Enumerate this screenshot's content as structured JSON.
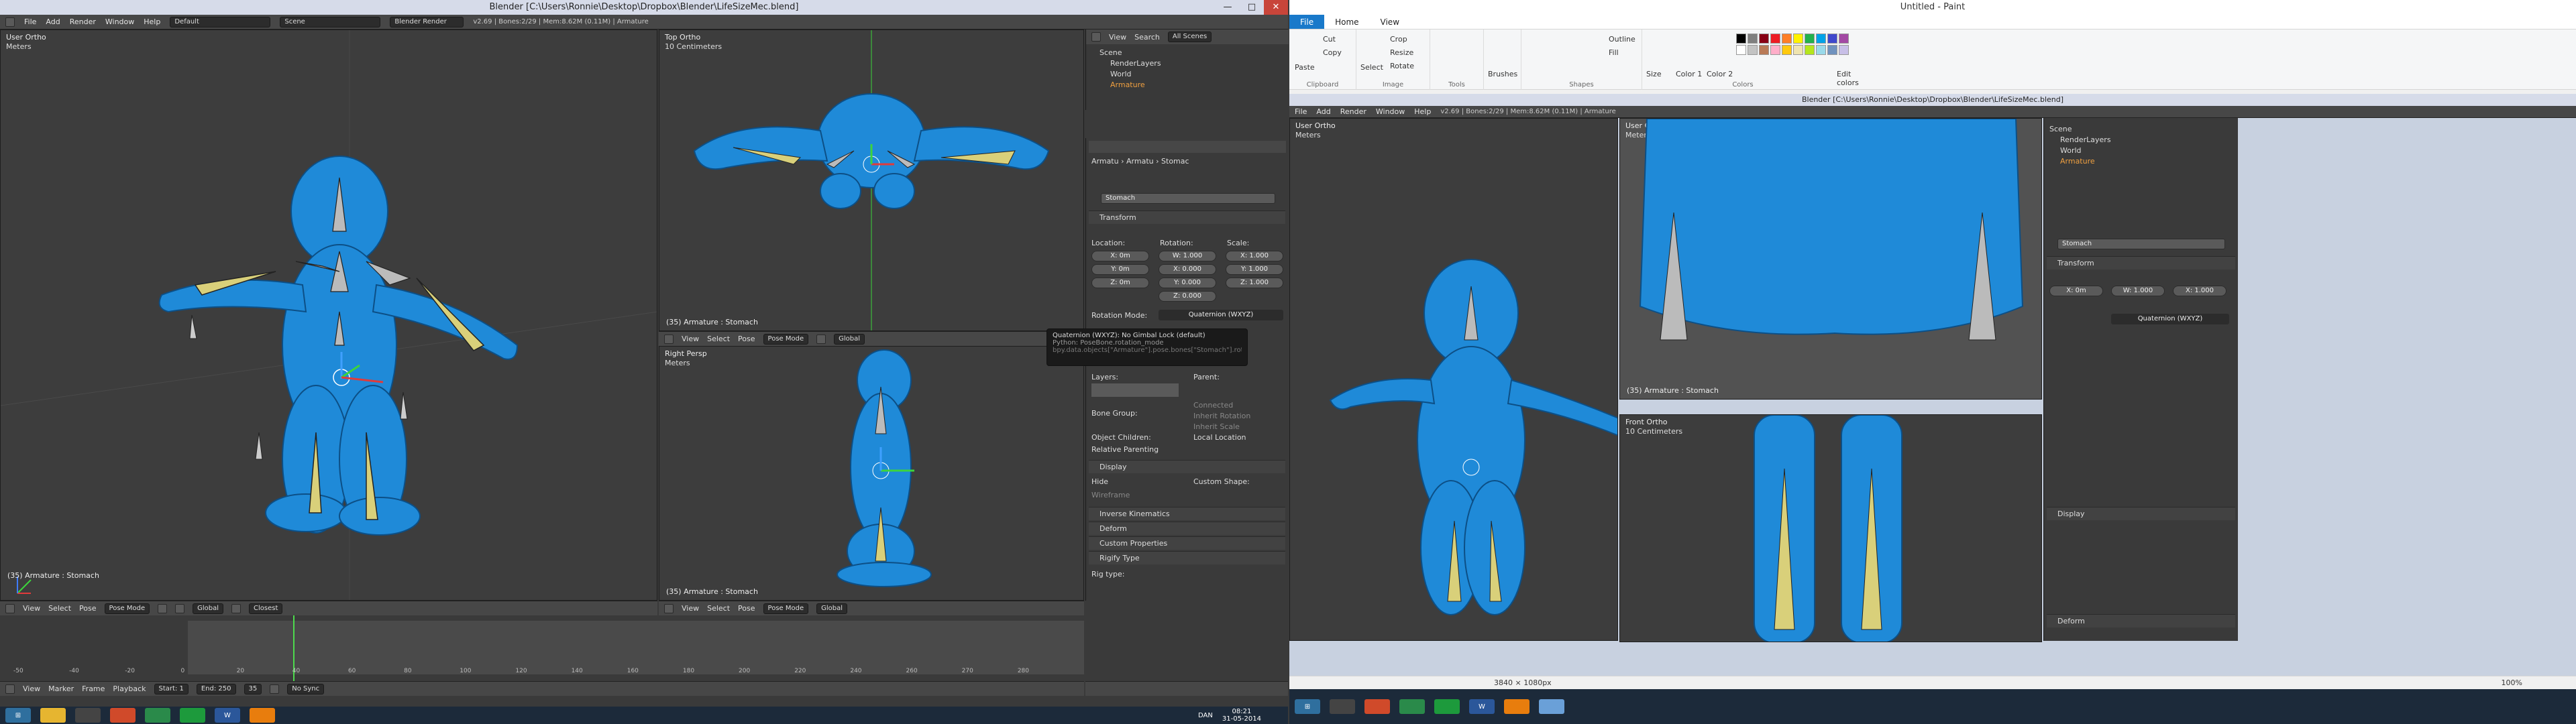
{
  "left": {
    "title": "Blender [C:\\Users\\Ronnie\\Desktop\\Dropbox\\Blender\\LifeSizeMec.blend]",
    "menu": [
      "File",
      "Add",
      "Render",
      "Window",
      "Help"
    ],
    "layout": "Default",
    "scene": "Scene",
    "engine": "Blender Render",
    "stats": "v2.69 | Bones:2/29 | Mem:8.62M (0.11M) | Armature",
    "vp_user": {
      "label": "User Ortho",
      "sub": "Meters",
      "obj": "(35) Armature : Stomach"
    },
    "vp_top": {
      "label": "Top Ortho",
      "sub": "10 Centimeters",
      "obj": "(35) Armature : Stomach"
    },
    "vp_right": {
      "label": "Right Persp",
      "sub": "Meters",
      "obj": "(35) Armature : Stomach"
    },
    "hdr": {
      "view": "View",
      "select": "Select",
      "pose": "Pose",
      "mode": "Pose Mode",
      "global": "Global",
      "closest": "Closest"
    },
    "outliner": {
      "view": "View",
      "search": "Search",
      "filter": "All Scenes",
      "items": [
        "Scene",
        "RenderLayers",
        "World",
        "Armature"
      ]
    },
    "props": {
      "breadcrumb": [
        "Armatu",
        "Armatu",
        "Stomac"
      ],
      "bone": "Stomach",
      "transform": "Transform",
      "location": "Location:",
      "rotation": "Rotation:",
      "scale": "Scale:",
      "loc": [
        "X: 0m",
        "Y: 0m",
        "Z: 0m"
      ],
      "rot": [
        "W: 1.000",
        "X: 0.000",
        "Y: 0.000",
        "Z: 0.000"
      ],
      "scl": [
        "X: 1.000",
        "Y: 1.000",
        "Z: 1.000"
      ],
      "rotmode_label": "Rotation Mode:",
      "rotmode": "Quaternion (WXYZ)",
      "tooltip": [
        "Quaternion (WXYZ): No Gimbal Lock (default)",
        "Python: PoseBone.rotation_mode",
        "bpy.data.objects[\"Armature\"].pose.bones[\"Stomach\"].rotation_mode"
      ],
      "layers": "Layers:",
      "parent": "Parent:",
      "connected": "Connected",
      "inherit_rot": "Inherit Rotation",
      "inherit_scale": "Inherit Scale",
      "local_loc": "Local Location",
      "bone_group": "Bone Group:",
      "object_children": "Object Children:",
      "relative_parenting": "Relative Parenting",
      "display": "Display",
      "hide": "Hide",
      "wireframe": "Wireframe",
      "custom_shape": "Custom Shape:",
      "ik": "Inverse Kinematics",
      "deform": "Deform",
      "custom_props": "Custom Properties",
      "rigify": "Rigify Type",
      "rig_type": "Rig type:"
    },
    "timeline": {
      "view": "View",
      "marker": "Marker",
      "frame": "Frame",
      "playback": "Playback",
      "start": "Start: 1",
      "end": "End: 250",
      "frame_no": "35",
      "nosync": "No Sync",
      "ticks": [
        "-50",
        "-40",
        "-20",
        "0",
        "20",
        "40",
        "60",
        "80",
        "100",
        "120",
        "140",
        "160",
        "180",
        "200",
        "220",
        "240",
        "260",
        "270",
        "280"
      ]
    }
  },
  "right": {
    "paint_title": "Untitled - Paint",
    "tabs": [
      "File",
      "Home",
      "View"
    ],
    "groups": {
      "clipboard": "Clipboard",
      "image": "Image",
      "tools": "Tools",
      "shapes": "Shapes",
      "colors": "Colors"
    },
    "clip": {
      "paste": "Paste",
      "cut": "Cut",
      "copy": "Copy"
    },
    "img": {
      "select": "Select",
      "crop": "Crop",
      "resize": "Resize",
      "rotate": "Rotate"
    },
    "brushes": "Brushes",
    "outline": "Outline",
    "fill": "Fill",
    "size": "Size",
    "color1": "Color 1",
    "color2": "Color 2",
    "edit_colors": "Edit colors",
    "colors": [
      "#000000",
      "#7f7f7f",
      "#880015",
      "#ed1c24",
      "#ff7f27",
      "#fff200",
      "#22b14c",
      "#00a2e8",
      "#3f48cc",
      "#a349a4",
      "#ffffff",
      "#c3c3c3",
      "#b97a57",
      "#ffaec9",
      "#ffc90e",
      "#efe4b0",
      "#b5e61d",
      "#99d9ea",
      "#7092be",
      "#c8bfe7"
    ],
    "blender_title": "Blender [C:\\Users\\Ronnie\\Desktop\\Dropbox\\Blender\\LifeSizeMec.blend]",
    "vp_user": {
      "label": "User Ortho",
      "sub": "Meters"
    },
    "vp_front": {
      "label": "Front Ortho",
      "sub": "10 Centimeters"
    },
    "vp_top_obj": "(35) Armature : Stomach",
    "status_size": "3840 × 1080px",
    "zoom": "100%"
  },
  "taskbar": {
    "lang": "DAN",
    "time": "08:21",
    "date": "31-05-2014"
  }
}
